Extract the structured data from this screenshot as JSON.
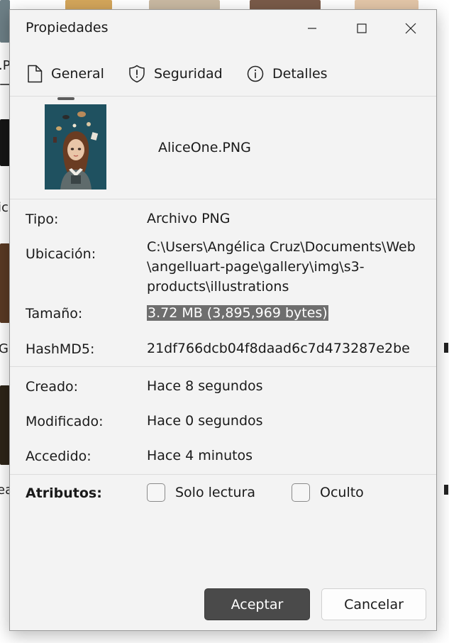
{
  "window": {
    "title": "Propiedades",
    "controls": [
      "minimize-icon",
      "maximize-icon",
      "close-icon"
    ]
  },
  "tabs": [
    {
      "label": "General",
      "icon": "document-icon",
      "selected": true
    },
    {
      "label": "Seguridad",
      "icon": "shield-icon",
      "selected": false
    },
    {
      "label": "Detalles",
      "icon": "info-icon",
      "selected": false
    }
  ],
  "file": {
    "name": "AliceOne.PNG"
  },
  "properties": {
    "type": {
      "label": "Tipo:",
      "value": "Archivo PNG"
    },
    "location": {
      "label": "Ubicación:",
      "line1": "C:\\Users\\Angélica Cruz\\Documents\\Web",
      "line2": "\\angelluart-page\\gallery\\img\\s3-",
      "line3": "products\\illustrations"
    },
    "size": {
      "label": "Tamaño:",
      "value": "3.72 MB (3,895,969 bytes)"
    },
    "hash": {
      "label": "HashMD5:",
      "value": "21df766dcb04f8daad6c7d473287e2be"
    },
    "created": {
      "label": "Creado:",
      "value": "Hace 8 segundos"
    },
    "modified": {
      "label": "Modificado:",
      "value": "Hace 0 segundos"
    },
    "accessed": {
      "label": "Accedido:",
      "value": "Hace 4 minutos"
    }
  },
  "attributes": {
    "label": "Atributos:",
    "readonly": {
      "label": "Solo lectura",
      "checked": false
    },
    "hidden": {
      "label": "Oculto",
      "checked": false
    }
  },
  "buttons": {
    "accept": "Aceptar",
    "cancel": "Cancelar"
  },
  "background_fragments": {
    "a": ".P",
    "b": "ic",
    "c": "G",
    "d": "ea"
  },
  "colors": {
    "accent_button": "#4a4a4a",
    "selection_highlight": "#6e6e6e",
    "window_bg": "#f3f3f3"
  }
}
